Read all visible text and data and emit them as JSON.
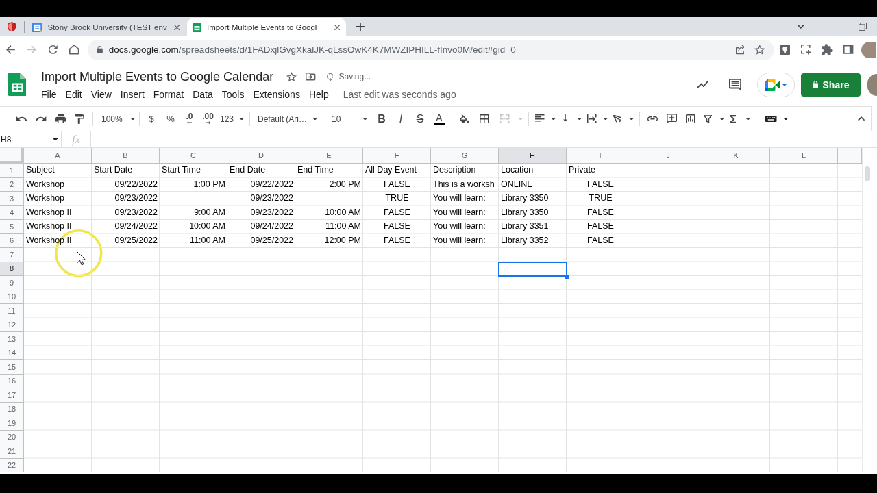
{
  "browser": {
    "tabs": [
      {
        "title": "Stony Brook University (TEST env",
        "selected": false
      },
      {
        "title": "Import Multiple Events to Googl",
        "selected": true
      }
    ],
    "address": {
      "host": "docs.google.com",
      "path": "/spreadsheets/d/1FADxjlGvgXkalJK-qLssOwK4K7MWZIPHILL-fInvo0M/edit#gid=0"
    }
  },
  "document": {
    "title": "Import Multiple Events to Google Calendar",
    "status": "Saving...",
    "menu": [
      "File",
      "Edit",
      "View",
      "Insert",
      "Format",
      "Data",
      "Tools",
      "Extensions",
      "Help"
    ],
    "last_edit": "Last edit was seconds ago",
    "share": "Share"
  },
  "toolbar": {
    "zoom": "100%",
    "currency": "$",
    "percent": "%",
    "decrease_decimals": ".0",
    "increase_decimals": ".00",
    "number_format": "123",
    "font": "Default (Ari…",
    "font_size": "10",
    "bold": "B",
    "italic": "I",
    "strikethrough": "S",
    "text_color": "A",
    "merge_cells": {
      "disabled": true
    }
  },
  "formula_bar": {
    "name_box": "H8",
    "function_label": "fx"
  },
  "sheet": {
    "columns": [
      {
        "letter": "A",
        "selected": false
      },
      {
        "letter": "B",
        "selected": false
      },
      {
        "letter": "C",
        "selected": false
      },
      {
        "letter": "D",
        "selected": false
      },
      {
        "letter": "E",
        "selected": false
      },
      {
        "letter": "F",
        "selected": false
      },
      {
        "letter": "G",
        "selected": false
      },
      {
        "letter": "H",
        "selected": true
      },
      {
        "letter": "I",
        "selected": false
      },
      {
        "letter": "J",
        "selected": false
      },
      {
        "letter": "K",
        "selected": false
      },
      {
        "letter": "L",
        "selected": false
      }
    ],
    "rows": [
      {
        "number": "1",
        "selected": false,
        "cells": [
          {
            "text": "Subject",
            "kind": "text"
          },
          {
            "text": "Start Date",
            "kind": "text"
          },
          {
            "text": "Start Time",
            "kind": "text"
          },
          {
            "text": "End Date",
            "kind": "text"
          },
          {
            "text": "End Time",
            "kind": "text"
          },
          {
            "text": "All Day Event",
            "kind": "text"
          },
          {
            "text": "Description",
            "kind": "text"
          },
          {
            "text": "Location",
            "kind": "text"
          },
          {
            "text": "Private",
            "kind": "text"
          }
        ]
      },
      {
        "number": "2",
        "selected": false,
        "cells": [
          {
            "text": "Workshop",
            "kind": "text"
          },
          {
            "text": "09/22/2022",
            "kind": "number"
          },
          {
            "text": "1:00 PM",
            "kind": "number"
          },
          {
            "text": "09/22/2022",
            "kind": "number"
          },
          {
            "text": "2:00 PM",
            "kind": "number"
          },
          {
            "text": "FALSE",
            "kind": "boolean"
          },
          {
            "text": "This is a worksh",
            "kind": "text"
          },
          {
            "text": "ONLINE",
            "kind": "text"
          },
          {
            "text": "FALSE",
            "kind": "boolean"
          }
        ]
      },
      {
        "number": "3",
        "selected": false,
        "cells": [
          {
            "text": "Workshop",
            "kind": "text"
          },
          {
            "text": "09/23/2022",
            "kind": "number"
          },
          {
            "kind": "blank"
          },
          {
            "text": "09/23/2022",
            "kind": "number"
          },
          {
            "kind": "blank"
          },
          {
            "text": "TRUE",
            "kind": "boolean"
          },
          {
            "text": "You will learn:",
            "kind": "text"
          },
          {
            "text": "Library 3350",
            "kind": "text"
          },
          {
            "text": "TRUE",
            "kind": "boolean"
          }
        ]
      },
      {
        "number": "4",
        "selected": false,
        "cells": [
          {
            "text": "Workshop II",
            "kind": "text"
          },
          {
            "text": "09/23/2022",
            "kind": "number"
          },
          {
            "text": "9:00 AM",
            "kind": "number"
          },
          {
            "text": "09/23/2022",
            "kind": "number"
          },
          {
            "text": "10:00 AM",
            "kind": "number"
          },
          {
            "text": "FALSE",
            "kind": "boolean"
          },
          {
            "text": "You will learn:",
            "kind": "text"
          },
          {
            "text": "Library 3350",
            "kind": "text"
          },
          {
            "text": "FALSE",
            "kind": "boolean"
          }
        ]
      },
      {
        "number": "5",
        "selected": false,
        "cells": [
          {
            "text": "Workshop II",
            "kind": "text"
          },
          {
            "text": "09/24/2022",
            "kind": "number"
          },
          {
            "text": "10:00 AM",
            "kind": "number"
          },
          {
            "text": "09/24/2022",
            "kind": "number"
          },
          {
            "text": "11:00 AM",
            "kind": "number"
          },
          {
            "text": "FALSE",
            "kind": "boolean"
          },
          {
            "text": "You will learn:",
            "kind": "text"
          },
          {
            "text": "Library 3351",
            "kind": "text"
          },
          {
            "text": "FALSE",
            "kind": "boolean"
          }
        ]
      },
      {
        "number": "6",
        "selected": false,
        "cells": [
          {
            "text": "Workshop II",
            "kind": "text"
          },
          {
            "text": "09/25/2022",
            "kind": "number"
          },
          {
            "text": "11:00 AM",
            "kind": "number"
          },
          {
            "text": "09/25/2022",
            "kind": "number"
          },
          {
            "text": "12:00 PM",
            "kind": "number"
          },
          {
            "text": "FALSE",
            "kind": "boolean"
          },
          {
            "text": "You will learn:",
            "kind": "text"
          },
          {
            "text": "Library 3352",
            "kind": "text"
          },
          {
            "text": "FALSE",
            "kind": "boolean"
          }
        ]
      },
      {
        "number": "7",
        "selected": false
      },
      {
        "number": "8",
        "selected": true
      },
      {
        "number": "9",
        "selected": false
      },
      {
        "number": "10",
        "selected": false
      },
      {
        "number": "11",
        "selected": false
      },
      {
        "number": "12",
        "selected": false
      },
      {
        "number": "13",
        "selected": false
      },
      {
        "number": "14",
        "selected": false
      },
      {
        "number": "15",
        "selected": false
      },
      {
        "number": "16",
        "selected": false
      },
      {
        "number": "17",
        "selected": false
      },
      {
        "number": "18",
        "selected": false
      },
      {
        "number": "19",
        "selected": false
      },
      {
        "number": "20",
        "selected": false
      },
      {
        "number": "21",
        "selected": false
      },
      {
        "number": "22",
        "selected": false
      }
    ]
  }
}
